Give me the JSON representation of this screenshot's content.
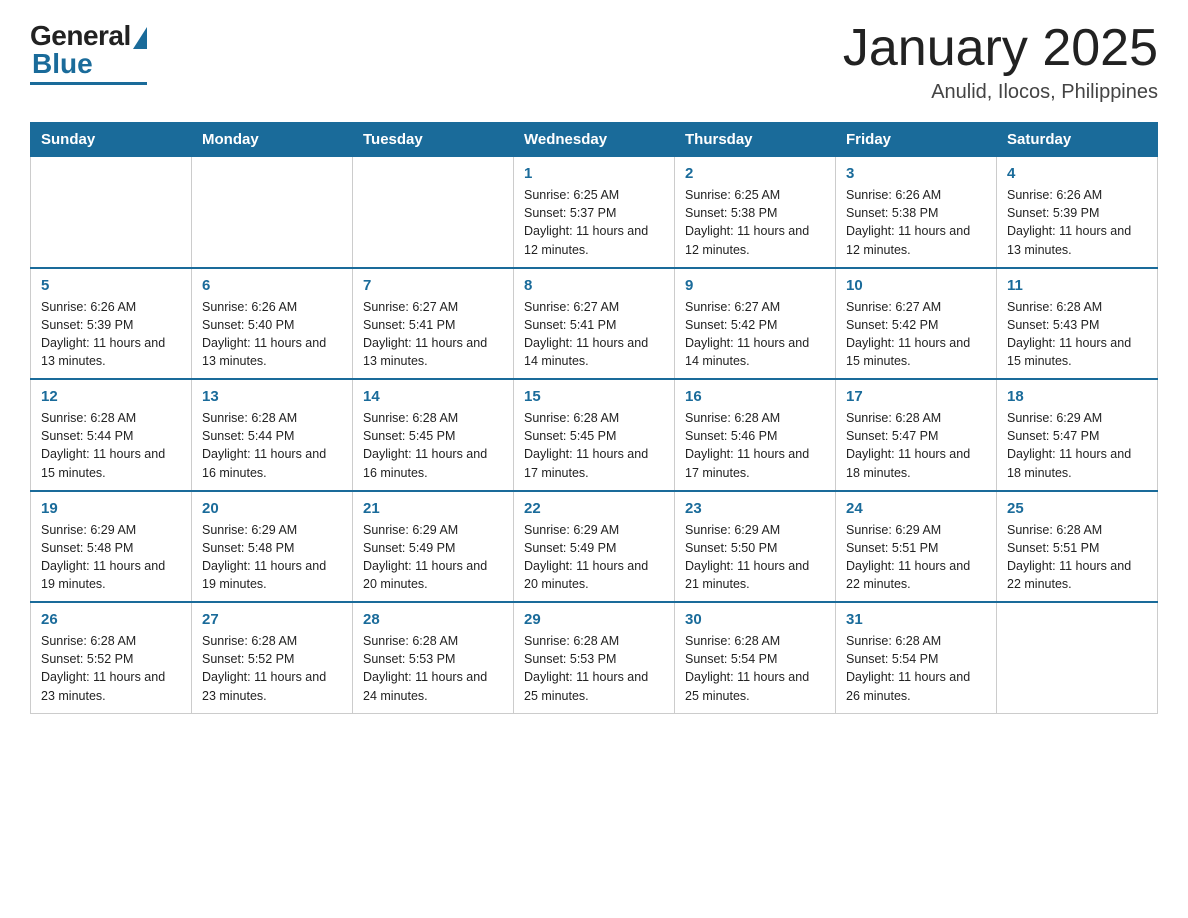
{
  "logo": {
    "general": "General",
    "blue": "Blue"
  },
  "header": {
    "month": "January 2025",
    "location": "Anulid, Ilocos, Philippines"
  },
  "days_of_week": [
    "Sunday",
    "Monday",
    "Tuesday",
    "Wednesday",
    "Thursday",
    "Friday",
    "Saturday"
  ],
  "weeks": [
    [
      {
        "day": "",
        "sunrise": "",
        "sunset": "",
        "daylight": ""
      },
      {
        "day": "",
        "sunrise": "",
        "sunset": "",
        "daylight": ""
      },
      {
        "day": "",
        "sunrise": "",
        "sunset": "",
        "daylight": ""
      },
      {
        "day": "1",
        "sunrise": "Sunrise: 6:25 AM",
        "sunset": "Sunset: 5:37 PM",
        "daylight": "Daylight: 11 hours and 12 minutes."
      },
      {
        "day": "2",
        "sunrise": "Sunrise: 6:25 AM",
        "sunset": "Sunset: 5:38 PM",
        "daylight": "Daylight: 11 hours and 12 minutes."
      },
      {
        "day": "3",
        "sunrise": "Sunrise: 6:26 AM",
        "sunset": "Sunset: 5:38 PM",
        "daylight": "Daylight: 11 hours and 12 minutes."
      },
      {
        "day": "4",
        "sunrise": "Sunrise: 6:26 AM",
        "sunset": "Sunset: 5:39 PM",
        "daylight": "Daylight: 11 hours and 13 minutes."
      }
    ],
    [
      {
        "day": "5",
        "sunrise": "Sunrise: 6:26 AM",
        "sunset": "Sunset: 5:39 PM",
        "daylight": "Daylight: 11 hours and 13 minutes."
      },
      {
        "day": "6",
        "sunrise": "Sunrise: 6:26 AM",
        "sunset": "Sunset: 5:40 PM",
        "daylight": "Daylight: 11 hours and 13 minutes."
      },
      {
        "day": "7",
        "sunrise": "Sunrise: 6:27 AM",
        "sunset": "Sunset: 5:41 PM",
        "daylight": "Daylight: 11 hours and 13 minutes."
      },
      {
        "day": "8",
        "sunrise": "Sunrise: 6:27 AM",
        "sunset": "Sunset: 5:41 PM",
        "daylight": "Daylight: 11 hours and 14 minutes."
      },
      {
        "day": "9",
        "sunrise": "Sunrise: 6:27 AM",
        "sunset": "Sunset: 5:42 PM",
        "daylight": "Daylight: 11 hours and 14 minutes."
      },
      {
        "day": "10",
        "sunrise": "Sunrise: 6:27 AM",
        "sunset": "Sunset: 5:42 PM",
        "daylight": "Daylight: 11 hours and 15 minutes."
      },
      {
        "day": "11",
        "sunrise": "Sunrise: 6:28 AM",
        "sunset": "Sunset: 5:43 PM",
        "daylight": "Daylight: 11 hours and 15 minutes."
      }
    ],
    [
      {
        "day": "12",
        "sunrise": "Sunrise: 6:28 AM",
        "sunset": "Sunset: 5:44 PM",
        "daylight": "Daylight: 11 hours and 15 minutes."
      },
      {
        "day": "13",
        "sunrise": "Sunrise: 6:28 AM",
        "sunset": "Sunset: 5:44 PM",
        "daylight": "Daylight: 11 hours and 16 minutes."
      },
      {
        "day": "14",
        "sunrise": "Sunrise: 6:28 AM",
        "sunset": "Sunset: 5:45 PM",
        "daylight": "Daylight: 11 hours and 16 minutes."
      },
      {
        "day": "15",
        "sunrise": "Sunrise: 6:28 AM",
        "sunset": "Sunset: 5:45 PM",
        "daylight": "Daylight: 11 hours and 17 minutes."
      },
      {
        "day": "16",
        "sunrise": "Sunrise: 6:28 AM",
        "sunset": "Sunset: 5:46 PM",
        "daylight": "Daylight: 11 hours and 17 minutes."
      },
      {
        "day": "17",
        "sunrise": "Sunrise: 6:28 AM",
        "sunset": "Sunset: 5:47 PM",
        "daylight": "Daylight: 11 hours and 18 minutes."
      },
      {
        "day": "18",
        "sunrise": "Sunrise: 6:29 AM",
        "sunset": "Sunset: 5:47 PM",
        "daylight": "Daylight: 11 hours and 18 minutes."
      }
    ],
    [
      {
        "day": "19",
        "sunrise": "Sunrise: 6:29 AM",
        "sunset": "Sunset: 5:48 PM",
        "daylight": "Daylight: 11 hours and 19 minutes."
      },
      {
        "day": "20",
        "sunrise": "Sunrise: 6:29 AM",
        "sunset": "Sunset: 5:48 PM",
        "daylight": "Daylight: 11 hours and 19 minutes."
      },
      {
        "day": "21",
        "sunrise": "Sunrise: 6:29 AM",
        "sunset": "Sunset: 5:49 PM",
        "daylight": "Daylight: 11 hours and 20 minutes."
      },
      {
        "day": "22",
        "sunrise": "Sunrise: 6:29 AM",
        "sunset": "Sunset: 5:49 PM",
        "daylight": "Daylight: 11 hours and 20 minutes."
      },
      {
        "day": "23",
        "sunrise": "Sunrise: 6:29 AM",
        "sunset": "Sunset: 5:50 PM",
        "daylight": "Daylight: 11 hours and 21 minutes."
      },
      {
        "day": "24",
        "sunrise": "Sunrise: 6:29 AM",
        "sunset": "Sunset: 5:51 PM",
        "daylight": "Daylight: 11 hours and 22 minutes."
      },
      {
        "day": "25",
        "sunrise": "Sunrise: 6:28 AM",
        "sunset": "Sunset: 5:51 PM",
        "daylight": "Daylight: 11 hours and 22 minutes."
      }
    ],
    [
      {
        "day": "26",
        "sunrise": "Sunrise: 6:28 AM",
        "sunset": "Sunset: 5:52 PM",
        "daylight": "Daylight: 11 hours and 23 minutes."
      },
      {
        "day": "27",
        "sunrise": "Sunrise: 6:28 AM",
        "sunset": "Sunset: 5:52 PM",
        "daylight": "Daylight: 11 hours and 23 minutes."
      },
      {
        "day": "28",
        "sunrise": "Sunrise: 6:28 AM",
        "sunset": "Sunset: 5:53 PM",
        "daylight": "Daylight: 11 hours and 24 minutes."
      },
      {
        "day": "29",
        "sunrise": "Sunrise: 6:28 AM",
        "sunset": "Sunset: 5:53 PM",
        "daylight": "Daylight: 11 hours and 25 minutes."
      },
      {
        "day": "30",
        "sunrise": "Sunrise: 6:28 AM",
        "sunset": "Sunset: 5:54 PM",
        "daylight": "Daylight: 11 hours and 25 minutes."
      },
      {
        "day": "31",
        "sunrise": "Sunrise: 6:28 AM",
        "sunset": "Sunset: 5:54 PM",
        "daylight": "Daylight: 11 hours and 26 minutes."
      },
      {
        "day": "",
        "sunrise": "",
        "sunset": "",
        "daylight": ""
      }
    ]
  ]
}
